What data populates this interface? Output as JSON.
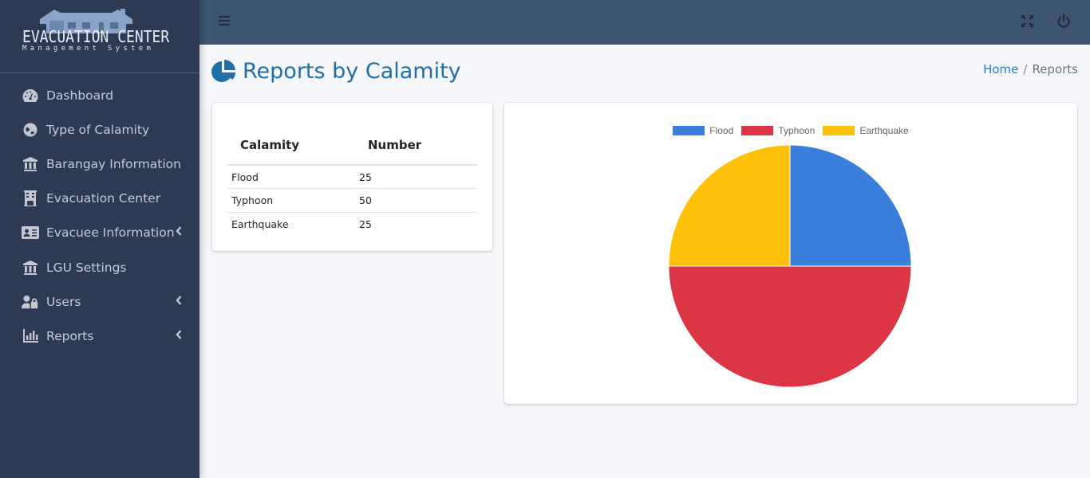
{
  "app": {
    "brand_title": "EVACUATION CENTER",
    "brand_subtitle": "Management System"
  },
  "sidebar": {
    "items": [
      {
        "label": "Dashboard",
        "icon": "tachometer-icon",
        "has_chevron": false
      },
      {
        "label": "Type of Calamity",
        "icon": "globe-icon",
        "has_chevron": false
      },
      {
        "label": "Barangay Information",
        "icon": "landmark-icon",
        "has_chevron": false
      },
      {
        "label": "Evacuation Center",
        "icon": "building-icon",
        "has_chevron": false
      },
      {
        "label": "Evacuee Information",
        "icon": "id-card-icon",
        "has_chevron": true
      },
      {
        "label": "LGU Settings",
        "icon": "landmark-icon",
        "has_chevron": false
      },
      {
        "label": "Users",
        "icon": "user-lock-icon",
        "has_chevron": true
      },
      {
        "label": "Reports",
        "icon": "chart-bar-icon",
        "has_chevron": true
      }
    ]
  },
  "topbar": {
    "menu_icon": "hamburger-icon",
    "expand_icon": "expand-icon",
    "power_icon": "power-icon"
  },
  "page": {
    "title": "Reports by Calamity",
    "title_icon": "pie-chart-icon",
    "breadcrumb": {
      "home": "Home",
      "separator": "/",
      "current": "Reports"
    }
  },
  "table": {
    "headers": [
      "Calamity",
      "Number"
    ],
    "rows": [
      [
        "Flood",
        "25"
      ],
      [
        "Typhoon",
        "50"
      ],
      [
        "Earthquake",
        "25"
      ]
    ]
  },
  "colors": {
    "sidebar_bg": "#2c3b52",
    "topbar_bg": "#3e5570",
    "title_color": "#226ea6",
    "link_color": "#2b7cd3"
  },
  "chart_data": {
    "type": "pie",
    "title": "",
    "categories": [
      "Flood",
      "Typhoon",
      "Earthquake"
    ],
    "values": [
      25,
      50,
      25
    ],
    "colors": [
      "#3a7fdc",
      "#dc3545",
      "#ffc107"
    ],
    "legend": "top",
    "start_angle": "top, clockwise"
  }
}
